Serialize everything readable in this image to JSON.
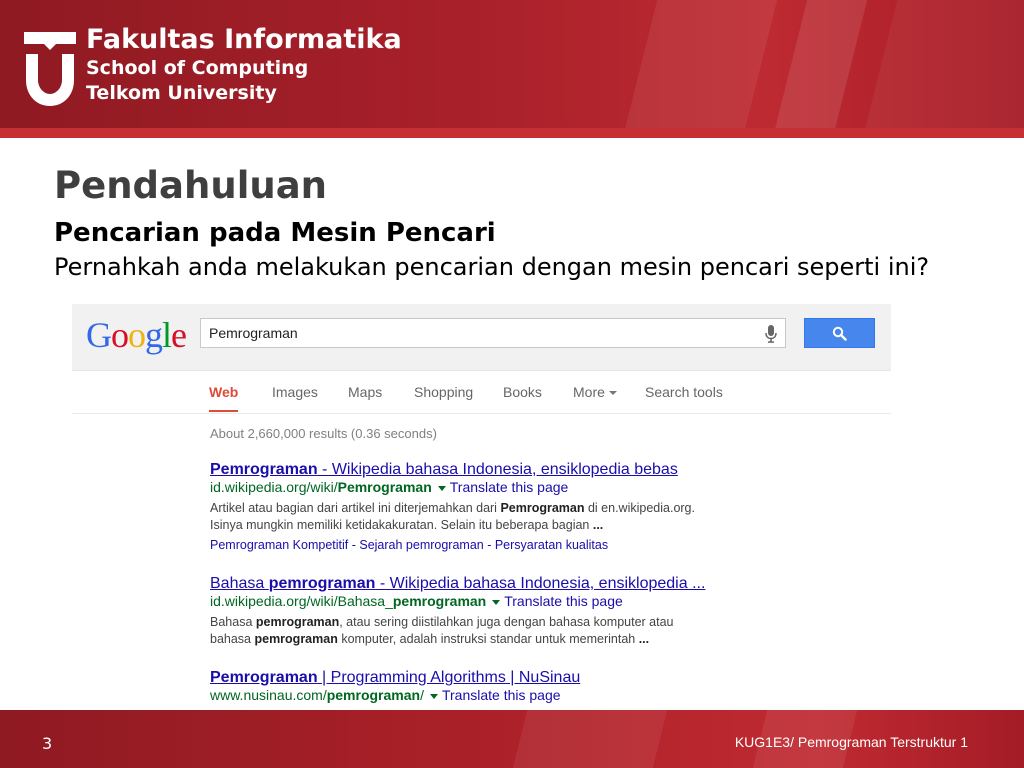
{
  "header": {
    "line1": "Fakultas Informatika",
    "line2": "School of Computing",
    "line3": "Telkom University"
  },
  "slide": {
    "title": "Pendahuluan",
    "subtitle": "Pencarian pada Mesin Pencari",
    "body": "Pernahkah anda melakukan pencarian dengan mesin pencari seperti ini?"
  },
  "google": {
    "logo_letters": [
      {
        "ch": "G",
        "color": "#3369e8"
      },
      {
        "ch": "o",
        "color": "#d50f25"
      },
      {
        "ch": "o",
        "color": "#eeb211"
      },
      {
        "ch": "g",
        "color": "#3369e8"
      },
      {
        "ch": "l",
        "color": "#009925"
      },
      {
        "ch": "e",
        "color": "#d50f25"
      }
    ],
    "query": "Pemrograman",
    "tabs": [
      "Web",
      "Images",
      "Maps",
      "Shopping",
      "Books",
      "More",
      "Search tools"
    ],
    "stats": "About 2,660,000 results (0.36 seconds)",
    "translate": "Translate this page",
    "results": [
      {
        "title_bold": "Pemrograman",
        "title_rest": " - Wikipedia bahasa Indonesia, ensiklopedia bebas",
        "url_pre": "id.wikipedia.org/wiki/",
        "url_bold": "Pemrograman",
        "url_post": "",
        "snippet_1a": "Artikel atau bagian dari artikel ini diterjemahkan dari ",
        "snippet_1b": "Pemrograman",
        "snippet_1c": " di en.wikipedia.org.",
        "snippet_2": "Isinya mungkin memiliki ketidakakuratan. Selain itu beberapa bagian ",
        "snippet_2b": "...",
        "sitelinks": "Pemrograman Kompetitif - Sejarah pemrograman - Persyaratan kualitas"
      },
      {
        "title_pre": "Bahasa ",
        "title_bold": "pemrograman",
        "title_rest": " - Wikipedia bahasa Indonesia, ensiklopedia ...",
        "url_pre": "id.wikipedia.org/wiki/Bahasa_",
        "url_bold": "pemrograman",
        "snippet_1a": "Bahasa ",
        "snippet_1b": "pemrograman",
        "snippet_1c": ", atau sering diistilahkan juga dengan bahasa komputer atau",
        "snippet_2a": "bahasa ",
        "snippet_2b": "pemrograman",
        "snippet_2c": " komputer, adalah instruksi standar untuk memerintah ",
        "snippet_2d": "..."
      },
      {
        "title_bold": "Pemrograman",
        "title_rest": " | Programming Algorithms | NuSinau",
        "url_pre": "www.nusinau.com/",
        "url_bold": "pemrograman",
        "url_post": "/"
      }
    ]
  },
  "footer": {
    "page": "3",
    "course": "KUG1E3/ Pemrograman Terstruktur 1"
  },
  "colors": {
    "brand_red": "#a8202a",
    "google_blue_button": "#4787ed",
    "link": "#1a0dab",
    "url_green": "#006621",
    "active_tab": "#dd4b39"
  }
}
